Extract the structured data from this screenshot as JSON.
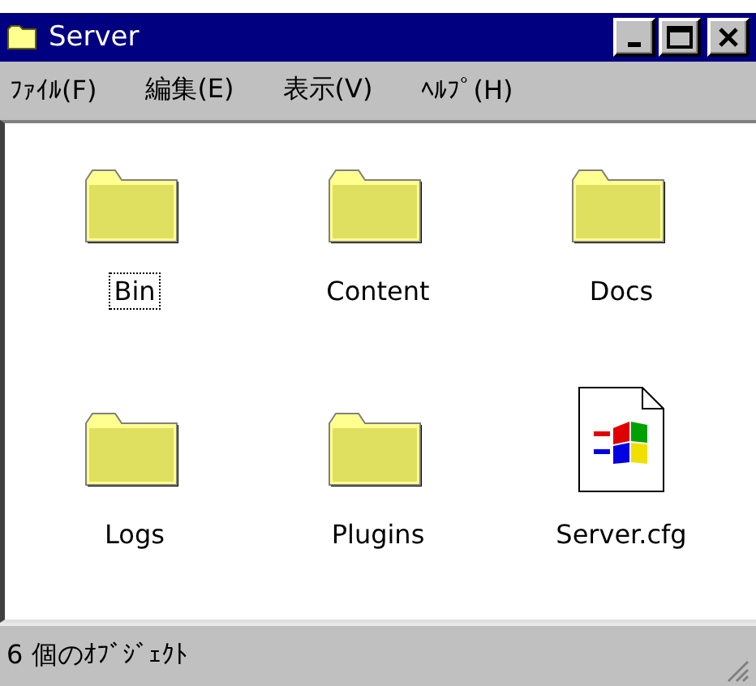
{
  "window": {
    "title": "Server"
  },
  "menu": [
    {
      "label": "ﾌｧｲﾙ(F)"
    },
    {
      "label": "編集(E)"
    },
    {
      "label": "表示(V)"
    },
    {
      "label": "ﾍﾙﾌﾟ(H)"
    }
  ],
  "items": [
    {
      "name": "Bin",
      "kind": "folder",
      "focused": true
    },
    {
      "name": "Content",
      "kind": "folder",
      "focused": false
    },
    {
      "name": "Docs",
      "kind": "folder",
      "focused": false
    },
    {
      "name": "Logs",
      "kind": "folder",
      "focused": false
    },
    {
      "name": "Plugins",
      "kind": "folder",
      "focused": false
    },
    {
      "name": "Server.cfg",
      "kind": "config-file",
      "focused": false
    }
  ],
  "status_bar": {
    "text": "6 個のｵﾌﾞｼﾞｪｸﾄ"
  }
}
